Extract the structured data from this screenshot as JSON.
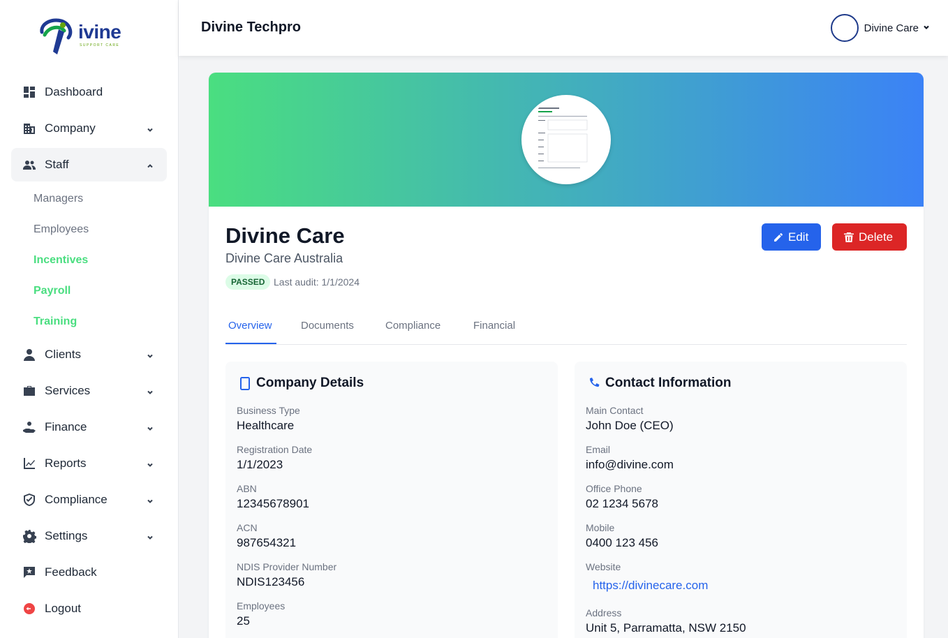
{
  "brand": {
    "logo_word": "ivine",
    "logo_tagline": "SUPPORT CARE"
  },
  "header": {
    "title": "Divine Techpro",
    "user_name": "Divine Care"
  },
  "sidebar": {
    "items": [
      {
        "label": "Dashboard",
        "icon": "dashboard-icon"
      },
      {
        "label": "Company",
        "icon": "building-icon"
      },
      {
        "label": "Staff",
        "icon": "people-icon"
      },
      {
        "label": "Clients",
        "icon": "person-icon"
      },
      {
        "label": "Services",
        "icon": "briefcase-icon"
      },
      {
        "label": "Finance",
        "icon": "hand-coin-icon"
      },
      {
        "label": "Reports",
        "icon": "chart-line-icon"
      },
      {
        "label": "Compliance",
        "icon": "shield-icon"
      },
      {
        "label": "Settings",
        "icon": "gear-icon"
      },
      {
        "label": "Feedback",
        "icon": "feedback-icon"
      },
      {
        "label": "Logout",
        "icon": "logout-icon"
      }
    ],
    "staff_sub": [
      "Managers",
      "Employees",
      "Incentives",
      "Payroll",
      "Training"
    ]
  },
  "profile": {
    "name": "Divine Care",
    "subtitle": "Divine Care Australia",
    "status": "PASSED",
    "status_color": "#166534",
    "last_audit": "Last audit: 1/1/2024",
    "edit_label": "Edit",
    "delete_label": "Delete"
  },
  "tabs": [
    "Overview",
    "Documents",
    "Compliance",
    "Financial"
  ],
  "company_details": {
    "title": "Company Details",
    "fields": [
      {
        "label": "Business Type",
        "value": "Healthcare"
      },
      {
        "label": "Registration Date",
        "value": "1/1/2023"
      },
      {
        "label": "ABN",
        "value": "12345678901"
      },
      {
        "label": "ACN",
        "value": "987654321"
      },
      {
        "label": "NDIS Provider Number",
        "value": "NDIS123456"
      },
      {
        "label": "Employees",
        "value": "25"
      }
    ]
  },
  "contact_info": {
    "title": "Contact Information",
    "fields": [
      {
        "label": "Main Contact",
        "value": "John Doe (CEO)"
      },
      {
        "label": "Email",
        "value": "info@divine.com"
      },
      {
        "label": "Office Phone",
        "value": "02 1234 5678"
      },
      {
        "label": "Mobile",
        "value": "0400 123 456"
      },
      {
        "label": "Website",
        "value": "https://divinecare.com"
      },
      {
        "label": "Address",
        "value": "Unit 5, Parramatta, NSW 2150"
      }
    ]
  },
  "colors": {
    "accent": "#2563eb",
    "danger": "#dc2626",
    "green": "#4ade80"
  }
}
